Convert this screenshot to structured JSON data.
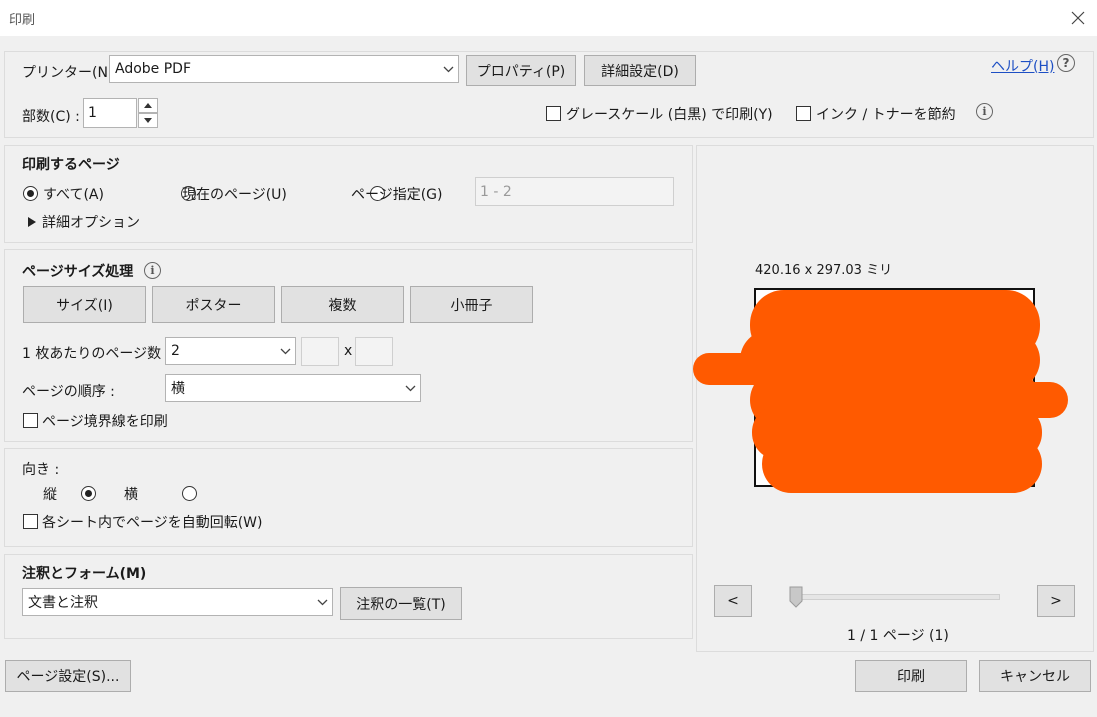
{
  "window": {
    "title": "印刷"
  },
  "printer": {
    "label": "プリンター(N) :",
    "selected": "Adobe PDF",
    "properties_button": "プロパティ(P)",
    "advanced_button": "詳細設定(D)",
    "help_link": "ヘルプ(H)",
    "copies_label": "部数(C) :",
    "copies_value": "1",
    "grayscale_label": "グレースケール (白黒) で印刷(Y)",
    "save_ink_label": "インク / トナーを節約"
  },
  "pages_to_print": {
    "heading": "印刷するページ",
    "all_label": "すべて(A)",
    "current_label": "現在のページ(U)",
    "range_label": "ページ指定(G)",
    "range_value": "1 - 2",
    "more_options": "詳細オプション"
  },
  "page_sizing": {
    "heading": "ページサイズ処理",
    "size_button": "サイズ(I)",
    "poster_button": "ポスター",
    "multiple_button": "複数",
    "booklet_button": "小冊子",
    "pages_per_sheet_label": "1 枚あたりのページ数 :",
    "pages_per_sheet_value": "2",
    "times": "x",
    "page_order_label": "ページの順序 :",
    "page_order_value": "横",
    "print_border_label": "ページ境界線を印刷"
  },
  "orientation": {
    "heading": "向き :",
    "portrait_label": "縦",
    "landscape_label": "横",
    "auto_rotate_label": "各シート内でページを自動回転(W)"
  },
  "comments_forms": {
    "heading": "注釈とフォーム(M)",
    "selected": "文書と注釈",
    "summarize_button": "注釈の一覧(T)"
  },
  "preview": {
    "size_text": "420.16 x 297.03 ミリ",
    "prev_button": "<",
    "next_button": ">",
    "page_indicator": "1 / 1 ページ (1)"
  },
  "footer": {
    "page_setup_button": "ページ設定(S)...",
    "print_button": "印刷",
    "cancel_button": "キャンセル"
  },
  "colors": {
    "redaction": "#ff5a00",
    "link": "#1d4fc4"
  }
}
